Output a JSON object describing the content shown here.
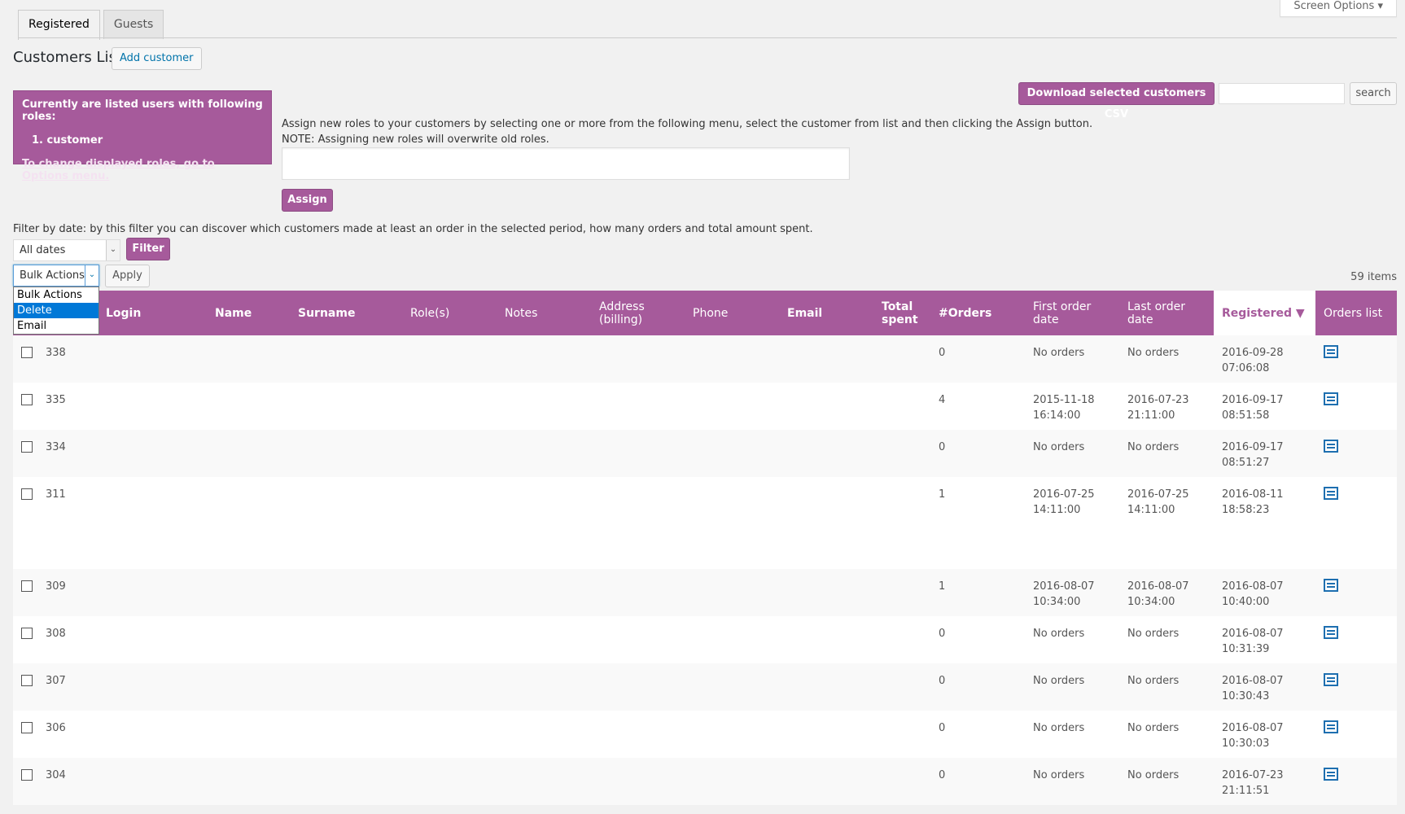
{
  "tabs": [
    {
      "label": "Registered"
    },
    {
      "label": "Guests"
    }
  ],
  "screen_options": "Screen Options",
  "page_title": "Customers List",
  "add_customer": "Add customer",
  "roles_box": {
    "line1": "Currently are listed users with following roles:",
    "line2": "1. customer",
    "line3": "To change displayed roles, go to Options menu."
  },
  "assign": {
    "text1": "Assign new roles to your customers by selecting one or more from the following menu, select the customer from list and then clicking the Assign button.",
    "text2": "NOTE: Assigning new roles will overwrite old roles.",
    "button": "Assign"
  },
  "download_csv": "Download selected customers CSV",
  "search_button": "search",
  "filter": {
    "text": "Filter by date: by this filter you can discover which customers made at least an order in the selected period, how many orders and total amount spent.",
    "dates_selected": "All dates",
    "button": "Filter"
  },
  "bulk": {
    "selected": "Bulk Actions",
    "options": [
      "Bulk Actions",
      "Delete",
      "Email"
    ],
    "highlighted": "Delete",
    "apply": "Apply"
  },
  "items_count": "59 items",
  "columns": {
    "login": "Login",
    "name": "Name",
    "surname": "Surname",
    "roles": "Role(s)",
    "notes": "Notes",
    "address": "Address (billing)",
    "phone": "Phone",
    "email": "Email",
    "total": "Total spent",
    "orders": "#Orders",
    "first": "First order date",
    "last": "Last order date",
    "registered": "Registered",
    "orders_list": "Orders list"
  },
  "rows": [
    {
      "id": "338",
      "orders": "0",
      "first": "No orders",
      "last": "No orders",
      "registered": "2016-09-28 07:06:08"
    },
    {
      "id": "335",
      "orders": "4",
      "first": "2015-11-18 16:14:00",
      "last": "2016-07-23 21:11:00",
      "registered": "2016-09-17 08:51:58"
    },
    {
      "id": "334",
      "orders": "0",
      "first": "No orders",
      "last": "No orders",
      "registered": "2016-09-17 08:51:27"
    },
    {
      "id": "311",
      "orders": "1",
      "first": "2016-07-25 14:11:00",
      "last": "2016-07-25 14:11:00",
      "registered": "2016-08-11 18:58:23"
    },
    {
      "id": "309",
      "orders": "1",
      "first": "2016-08-07 10:34:00",
      "last": "2016-08-07 10:34:00",
      "registered": "2016-08-07 10:40:00"
    },
    {
      "id": "308",
      "orders": "0",
      "first": "No orders",
      "last": "No orders",
      "registered": "2016-08-07 10:31:39"
    },
    {
      "id": "307",
      "orders": "0",
      "first": "No orders",
      "last": "No orders",
      "registered": "2016-08-07 10:30:43"
    },
    {
      "id": "306",
      "orders": "0",
      "first": "No orders",
      "last": "No orders",
      "registered": "2016-08-07 10:30:03"
    },
    {
      "id": "304",
      "orders": "0",
      "first": "No orders",
      "last": "No orders",
      "registered": "2016-07-23 21:11:51"
    }
  ]
}
